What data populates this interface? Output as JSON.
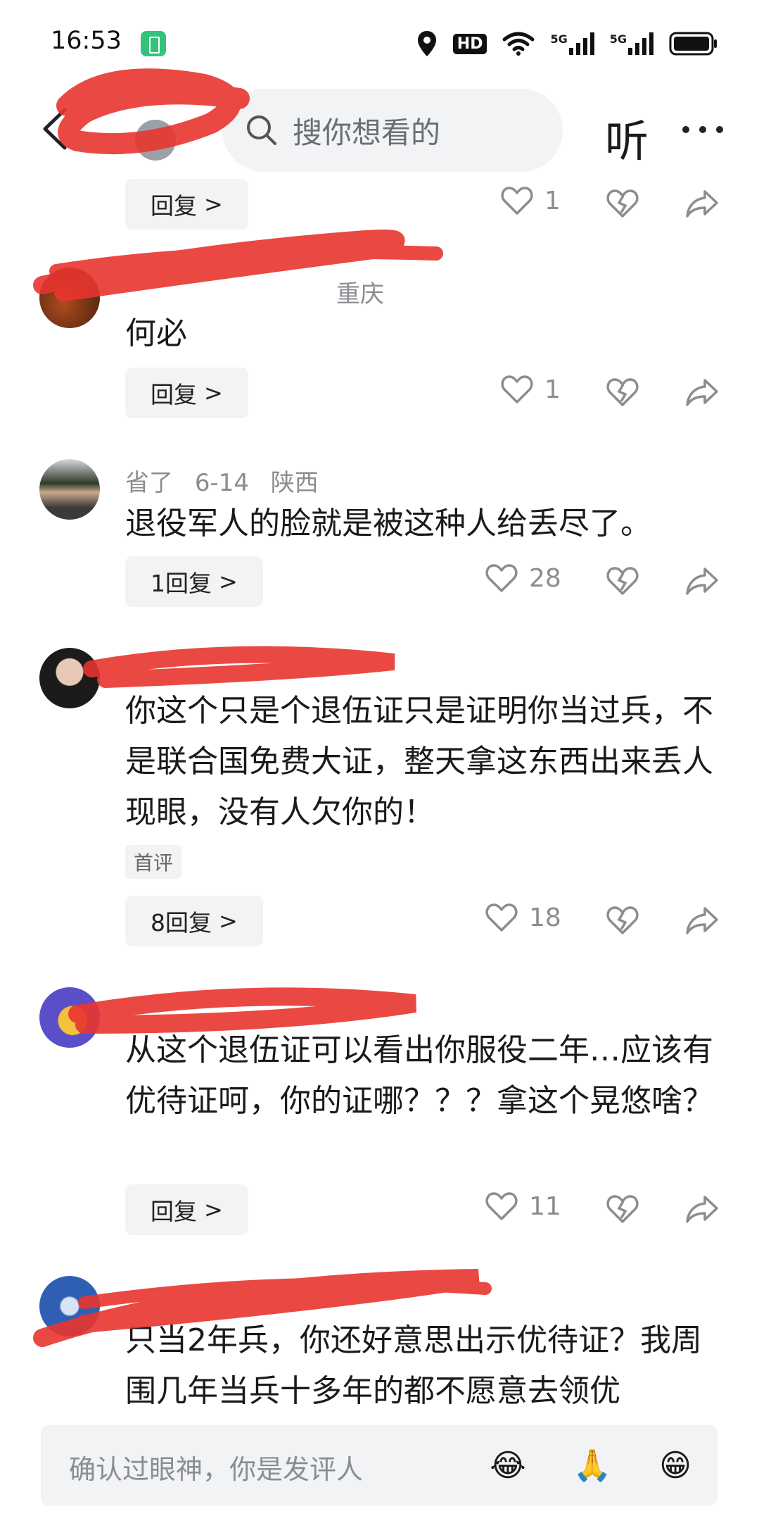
{
  "status_bar": {
    "time": "16:53",
    "hd_label": "HD",
    "signal1": "5G",
    "signal2": "5G"
  },
  "header": {
    "search_placeholder": "搜你想看的",
    "listen_label": "听",
    "more_label": "···"
  },
  "comments": [
    {
      "id": "partial-top",
      "reply_label": "回复",
      "likes": "1"
    },
    {
      "id": "c1",
      "meta_date": "",
      "meta_region": "重庆",
      "text": "何必",
      "reply_label": "回复",
      "likes": "1"
    },
    {
      "id": "c2",
      "user": "省了",
      "meta_date": "6-14",
      "meta_region": "陕西",
      "text": "退役军人的脸就是被这种人给丢尽了。",
      "reply_label": "1回复",
      "likes": "28"
    },
    {
      "id": "c3",
      "text": "你这个只是个退伍证只是证明你当过兵，不是联合国免费大证，整天拿这东西出来丢人现眼，没有人欠你的！",
      "tag": "首评",
      "reply_label": "8回复",
      "likes": "18"
    },
    {
      "id": "c4",
      "text": "从这个退伍证可以看出你服役二年…应该有优待证呵，你的证哪？？？拿这个晃悠啥？",
      "reply_label": "回复",
      "likes": "11"
    },
    {
      "id": "c5",
      "text": "只当2年兵，你还好意思出示优待证？我周围几年当兵十多年的都不愿意去领优"
    }
  ],
  "input_bar": {
    "placeholder": "确认过眼神，你是发评人",
    "emojis": [
      "😂",
      "🙏",
      "😁"
    ]
  },
  "colors": {
    "accent_redaction": "#e8352f",
    "bg_chip": "#f2f3f5",
    "meta_gray": "#8a8d91"
  }
}
